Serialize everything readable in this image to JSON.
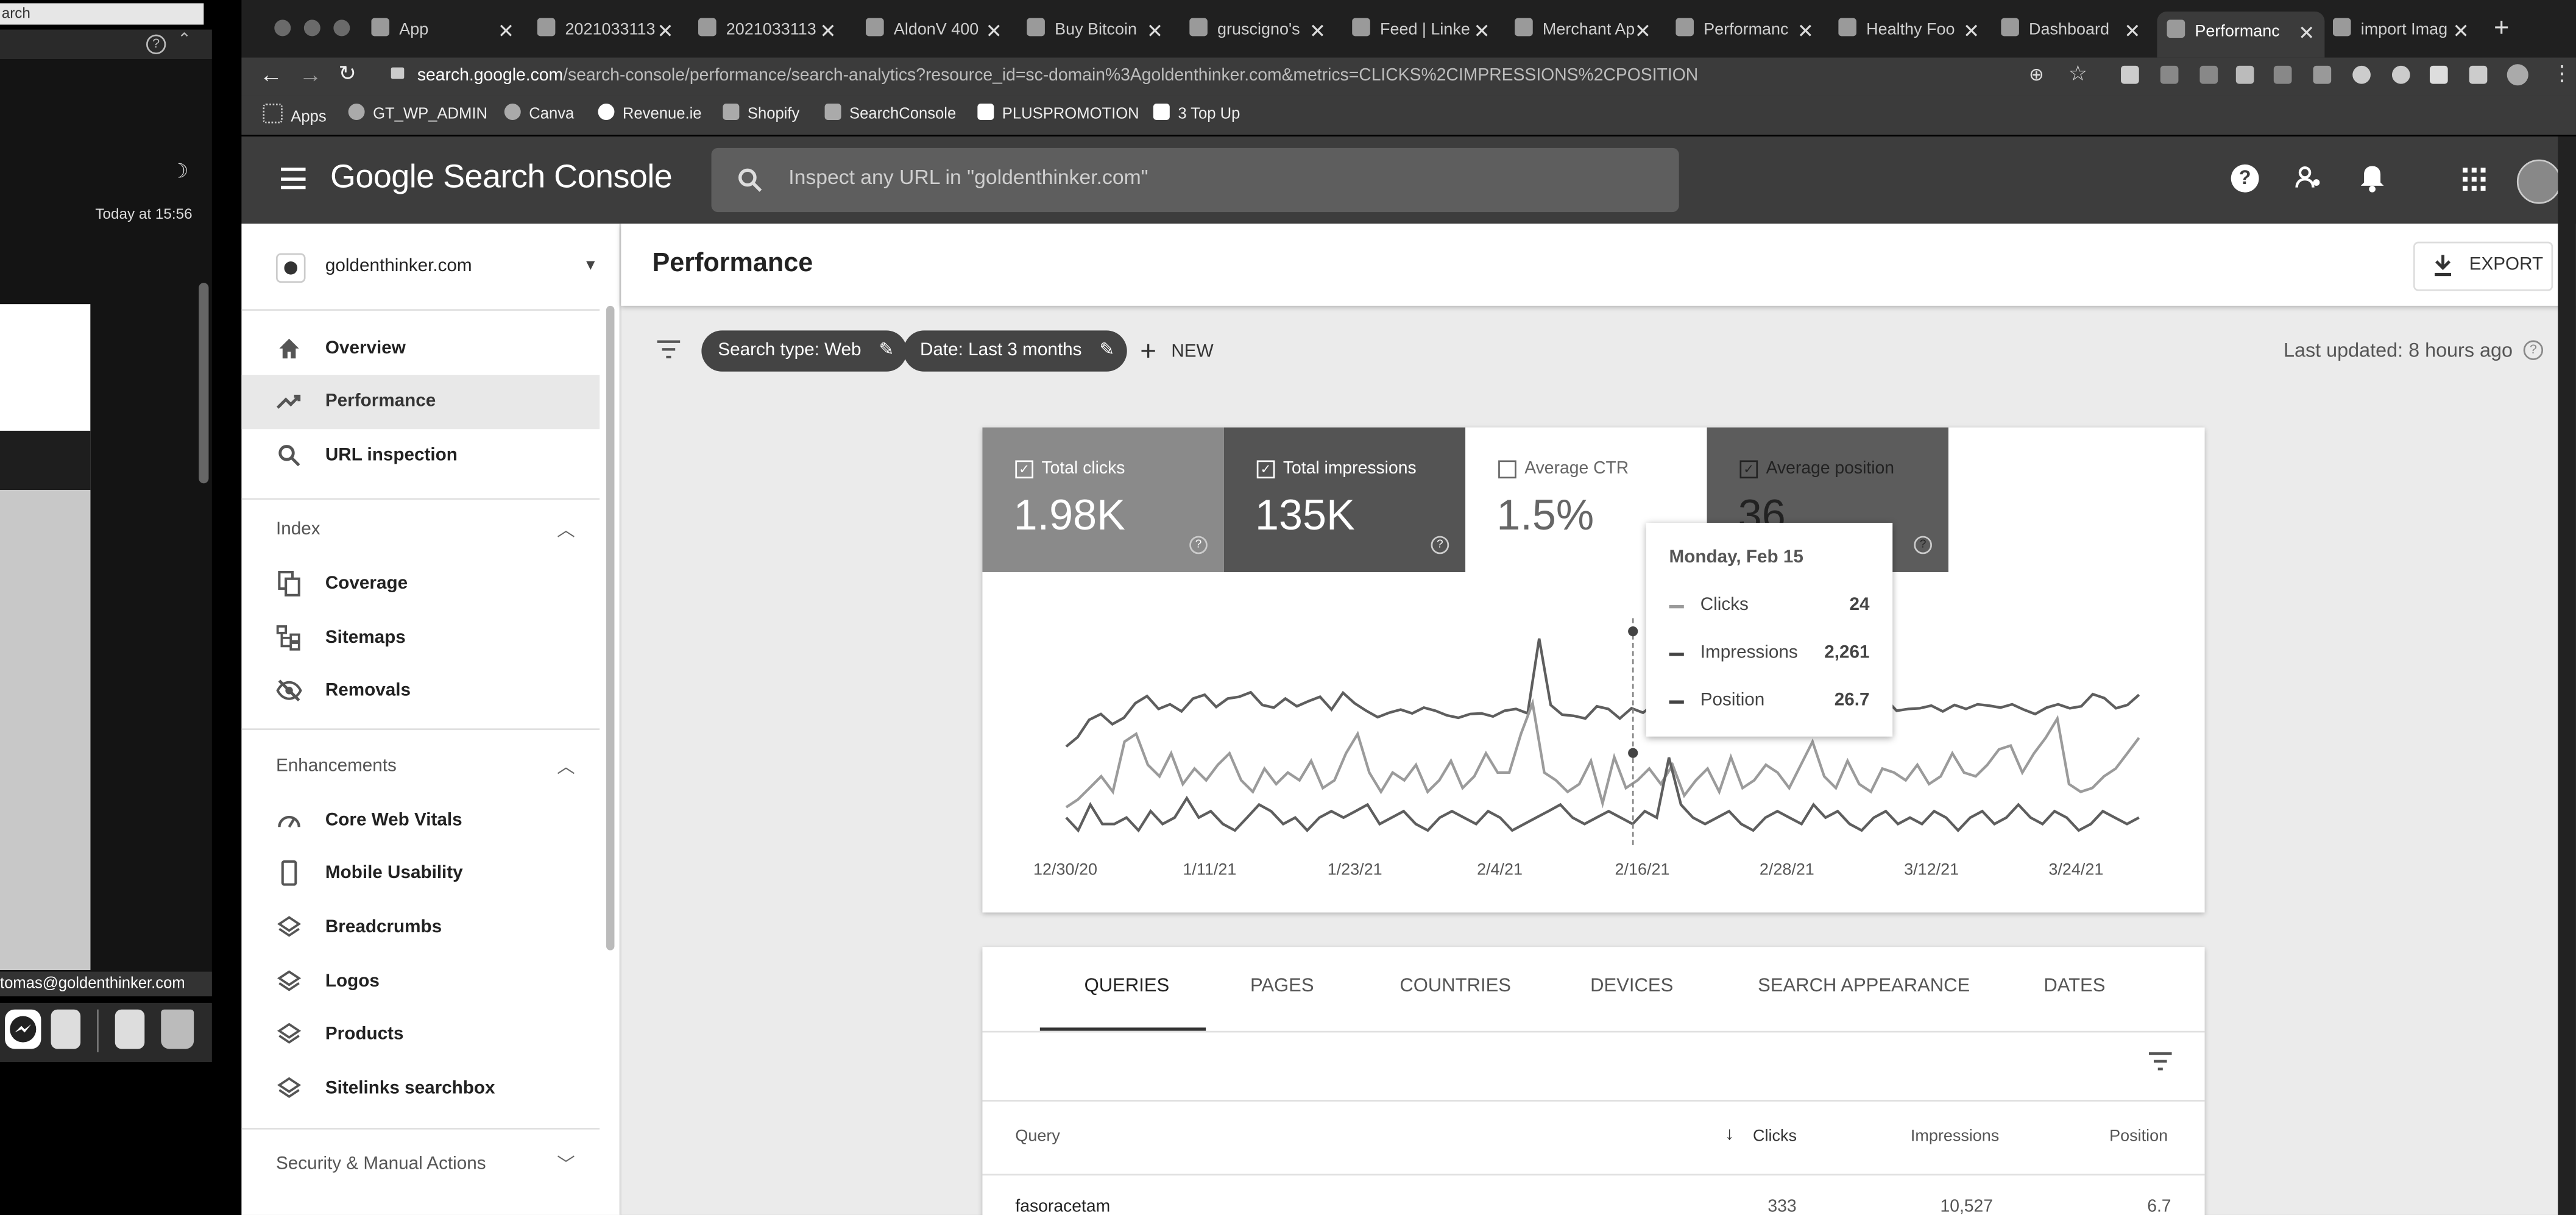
{
  "left_window": {
    "search_text": "arch",
    "timestamp": "Today at 15:56",
    "account_email": "tomas@goldenthinker.com"
  },
  "browser": {
    "tabs": [
      {
        "label": "App",
        "icon": "app-icon"
      },
      {
        "label": "2021033113",
        "icon": "chart-icon"
      },
      {
        "label": "2021033113",
        "icon": "chart-icon"
      },
      {
        "label": "AldonV 400",
        "icon": "shop-icon"
      },
      {
        "label": "Buy Bitcoin",
        "icon": "shop-icon"
      },
      {
        "label": "gruscigno's",
        "icon": "shop-icon"
      },
      {
        "label": "Feed | Linke",
        "icon": "linkedin-icon"
      },
      {
        "label": "Merchant Ap",
        "icon": "merchant-icon"
      },
      {
        "label": "Performanc",
        "icon": "search-console-icon"
      },
      {
        "label": "Healthy Foo",
        "icon": "shopify-icon"
      },
      {
        "label": "Dashboard",
        "icon": "shopify-icon"
      },
      {
        "label": "Performanc",
        "icon": "search-console-icon",
        "active": true
      },
      {
        "label": "import Imag",
        "icon": "google-icon"
      }
    ],
    "url_host": "search.google.com",
    "url_path": "/search-console/performance/search-analytics?resource_id=sc-domain%3Agoldenthinker.com&metrics=CLICKS%2CIMPRESSIONS%2CPOSITION",
    "bookmarks": [
      {
        "label": "Apps"
      },
      {
        "label": "GT_WP_ADMIN"
      },
      {
        "label": "Canva"
      },
      {
        "label": "Revenue.ie"
      },
      {
        "label": "Shopify"
      },
      {
        "label": "SearchConsole"
      },
      {
        "label": "PLUSPROMOTION"
      },
      {
        "label": "3 Top Up"
      }
    ]
  },
  "gsc": {
    "app_title": "Google Search Console",
    "search_placeholder": "Inspect any URL in \"goldenthinker.com\"",
    "property": "goldenthinker.com",
    "nav": [
      {
        "label": "Overview",
        "icon": "home-icon"
      },
      {
        "label": "Performance",
        "icon": "trending-up-icon",
        "selected": true
      },
      {
        "label": "URL inspection",
        "icon": "search-icon"
      }
    ],
    "index_section": {
      "title": "Index",
      "items": [
        {
          "label": "Coverage",
          "icon": "copy-icon"
        },
        {
          "label": "Sitemaps",
          "icon": "sitemap-icon"
        },
        {
          "label": "Removals",
          "icon": "eye-off-icon"
        }
      ]
    },
    "enhancements_section": {
      "title": "Enhancements",
      "items": [
        {
          "label": "Core Web Vitals",
          "icon": "speed-icon"
        },
        {
          "label": "Mobile Usability",
          "icon": "phone-icon"
        },
        {
          "label": "Breadcrumbs",
          "icon": "layers-icon"
        },
        {
          "label": "Logos",
          "icon": "layers-icon"
        },
        {
          "label": "Products",
          "icon": "layers-icon"
        },
        {
          "label": "Sitelinks searchbox",
          "icon": "layers-icon"
        }
      ]
    },
    "security_section": {
      "title": "Security & Manual Actions"
    },
    "page_title": "Performance",
    "export_label": "EXPORT",
    "filters": {
      "search_type": "Search type: Web",
      "date": "Date: Last 3 months",
      "new_label": "NEW",
      "last_updated": "Last updated: 8 hours ago"
    },
    "metrics": [
      {
        "label": "Total clicks",
        "value": "1.98K",
        "checked": true,
        "bg": "#8a8a8a"
      },
      {
        "label": "Total impressions",
        "value": "135K",
        "checked": true,
        "bg": "#545454"
      },
      {
        "label": "Average CTR",
        "value": "1.5%",
        "checked": false,
        "bg": "#ffffff"
      },
      {
        "label": "Average position",
        "value": "36",
        "checked": true,
        "bg": "#5c5c5c"
      }
    ],
    "tooltip": {
      "date": "Monday, Feb 15",
      "rows": [
        {
          "name": "Clicks",
          "value": "24"
        },
        {
          "name": "Impressions",
          "value": "2,261"
        },
        {
          "name": "Position",
          "value": "26.7"
        }
      ]
    },
    "x_ticks": [
      "12/30/20",
      "1/11/21",
      "1/23/21",
      "2/4/21",
      "2/16/21",
      "2/28/21",
      "3/12/21",
      "3/24/21"
    ],
    "table_tabs": [
      "QUERIES",
      "PAGES",
      "COUNTRIES",
      "DEVICES",
      "SEARCH APPEARANCE",
      "DATES"
    ],
    "table_headers": {
      "query": "Query",
      "clicks": "Clicks",
      "impressions": "Impressions",
      "position": "Position"
    },
    "rows": [
      {
        "query": "fasoracetam",
        "clicks": "333",
        "impressions": "10,527",
        "position": "6.7"
      }
    ]
  },
  "chart_data": {
    "type": "line",
    "x_start": "2020-12-30",
    "x_end": "2021-03-29",
    "ticks": [
      "12/30/20",
      "1/11/21",
      "1/23/21",
      "2/4/21",
      "2/16/21",
      "2/28/21",
      "3/12/21",
      "3/24/21"
    ],
    "series": [
      {
        "name": "Clicks",
        "color": "#9b9b9b",
        "values": [
          11,
          13,
          16,
          19,
          15,
          28,
          30,
          22,
          19,
          25,
          17,
          21,
          18,
          22,
          25,
          18,
          15,
          21,
          17,
          20,
          18,
          23,
          16,
          18,
          25,
          30,
          20,
          15,
          20,
          18,
          22,
          15,
          18,
          23,
          16,
          19,
          25,
          20,
          20,
          30,
          38,
          20,
          18,
          15,
          17,
          23,
          12,
          24,
          16,
          18,
          21,
          17,
          22,
          14,
          18,
          21,
          15,
          24,
          16,
          18,
          22,
          20,
          16,
          22,
          28,
          19,
          16,
          23,
          17,
          15,
          21,
          20,
          18,
          22,
          17,
          19,
          25,
          20,
          19,
          22,
          26,
          27,
          20,
          25,
          29,
          34,
          17,
          15,
          16,
          19,
          21,
          25,
          29
        ]
      },
      {
        "name": "Impressions",
        "color": "#5e5e5e",
        "values": [
          1300,
          1450,
          1720,
          1810,
          1650,
          1750,
          1980,
          2090,
          1890,
          1960,
          1850,
          2050,
          2110,
          1920,
          2050,
          2080,
          2150,
          1950,
          1910,
          2050,
          1930,
          2010,
          2080,
          1880,
          2140,
          1980,
          1860,
          1760,
          1830,
          1880,
          1820,
          1910,
          1860,
          1790,
          1750,
          1810,
          1820,
          1770,
          1860,
          1890,
          1820,
          2990,
          1950,
          1800,
          1780,
          1740,
          1930,
          1890,
          1740,
          1900,
          1830,
          1970,
          2080,
          1800,
          2100,
          1960,
          1900,
          2000,
          1950,
          1870,
          2090,
          1990,
          1960,
          1810,
          1880,
          2261,
          2010,
          1880,
          2040,
          1860,
          1930,
          2050,
          1860,
          1890,
          1900,
          1940,
          1850,
          1950,
          1890,
          1960,
          1940,
          1910,
          1960,
          1880,
          1810,
          1910,
          1960,
          1900,
          1930,
          2120,
          2060,
          1900,
          1950,
          2110
        ]
      },
      {
        "name": "Position",
        "color": "#5e5e5e",
        "values": [
          36,
          38,
          34,
          37,
          37,
          36,
          38,
          35,
          37,
          36,
          33,
          36,
          35,
          37,
          38,
          36,
          34,
          35,
          37,
          36,
          38,
          36,
          35,
          36,
          35,
          34,
          37,
          36,
          35,
          37,
          38,
          36,
          35,
          36,
          37,
          35,
          36,
          38,
          37,
          36,
          35,
          34,
          36,
          37,
          36,
          35,
          36,
          37,
          35,
          36,
          26.7,
          34,
          36,
          37,
          36,
          35,
          37,
          38,
          36,
          35,
          36,
          37,
          34,
          36,
          35,
          37,
          38,
          36,
          35,
          37,
          36,
          37,
          35,
          36,
          38,
          36,
          35,
          37,
          36,
          34,
          36,
          37,
          35,
          36,
          38,
          37,
          35,
          36,
          37,
          36
        ]
      }
    ]
  }
}
